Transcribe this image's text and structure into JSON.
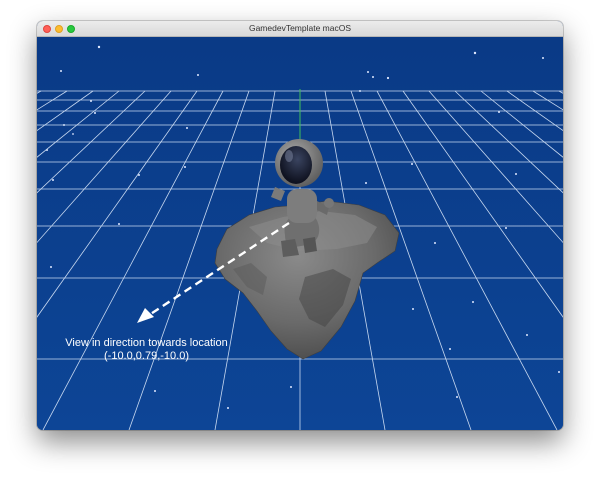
{
  "window": {
    "title": "GamedevTemplate macOS"
  },
  "scene": {
    "annotation_line1": "View in direction towards location",
    "annotation_line2": "(-10.0,0.79,-10.0)",
    "background_color": "#0b3d8c",
    "grid_color": "#c7d8f0",
    "arrow_color": "#ffffff"
  }
}
